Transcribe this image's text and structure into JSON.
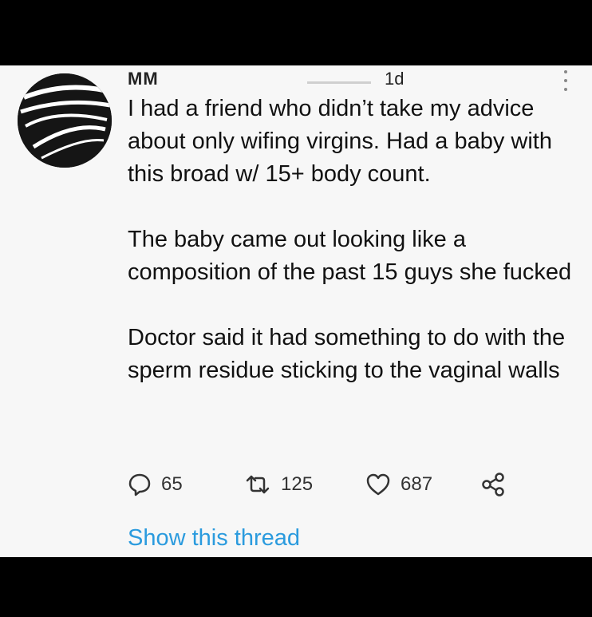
{
  "tweet": {
    "author_name": "MM",
    "time": "1d",
    "paragraphs": [
      "I had a friend who didn’t take my advice about only wifing virgins. Had a baby with this broad w/ 15+ body count.",
      "The baby came out looking like a composition of the past 15 guys she fucked",
      "Doctor said it had something to do with the sperm residue sticking to the vaginal walls"
    ],
    "actions": {
      "replies": "65",
      "retweets": "125",
      "likes": "687"
    },
    "show_thread": "Show this thread"
  },
  "icons": [
    "more-icon",
    "reply-icon",
    "retweet-icon",
    "like-icon",
    "share-icon"
  ],
  "colors": {
    "link": "#2b9bde",
    "card_bg": "#f7f7f7",
    "frame": "#000000"
  }
}
